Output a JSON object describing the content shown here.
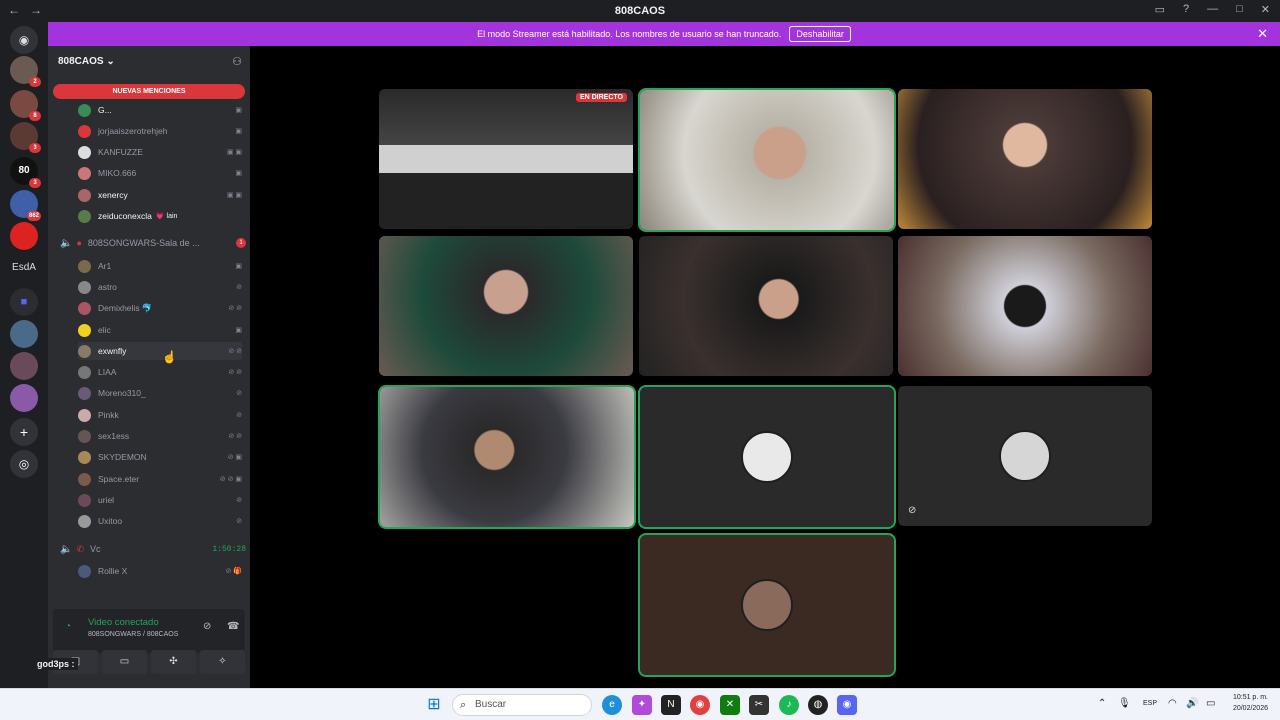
{
  "window": {
    "title": "808CAOS"
  },
  "banner": {
    "text": "El modo Streamer está habilitado. Los nombres de usuario se han truncado.",
    "button": "Deshabilitar"
  },
  "servers": [
    {
      "badge": "2"
    },
    {
      "badge": "8"
    },
    {
      "badge": "3"
    },
    {
      "badge": "3"
    },
    {
      "badge": "862"
    },
    {
      "badge": ""
    }
  ],
  "server_text": "EsdA",
  "guild": {
    "name": "808CAOS ⌄",
    "mentions": "NUEVAS MENCIONES"
  },
  "members_top": [
    {
      "name": "G...",
      "white": true,
      "icons": "▣"
    },
    {
      "name": "jorjaaiszerotrehjeh",
      "white": false,
      "icons": "▣"
    },
    {
      "name": "KANFUZZE",
      "white": false,
      "icons": "▣ ▣"
    },
    {
      "name": "MIKO.666",
      "white": false,
      "icons": "▣"
    },
    {
      "name": "xenercy",
      "white": true,
      "icons": "▣ ▣"
    },
    {
      "name": "zeiduconexcla",
      "white": true,
      "icons": "",
      "tag": "💗 lain"
    }
  ],
  "voice_channel": {
    "name": "808SONGWARS-Sala de ...",
    "badge": "1"
  },
  "members_voice": [
    {
      "name": "Ar1",
      "icons": "▣"
    },
    {
      "name": "astro",
      "icons": "⊘"
    },
    {
      "name": "Demixhelis 🐬",
      "icons": "⊘ ⊘"
    },
    {
      "name": "elic",
      "icons": "▣"
    },
    {
      "name": "exwnfly",
      "white": true,
      "icons": "⊘ ⊘"
    },
    {
      "name": "LIAA",
      "icons": "⊘ ⊘"
    },
    {
      "name": "Moreno310_",
      "icons": "⊘"
    },
    {
      "name": "Pinkk",
      "icons": "⊘"
    },
    {
      "name": "sex1ess",
      "icons": "⊘ ⊘"
    },
    {
      "name": "SKYDEMON",
      "icons": "⊘ ▣"
    },
    {
      "name": "Space.eter",
      "icons": "⊘ ⊘ ▣"
    },
    {
      "name": "uriel",
      "icons": "⊘"
    },
    {
      "name": "Uxitoo",
      "icons": "⊘"
    }
  ],
  "voice_channel_2": {
    "name": "Vc",
    "timer": "1:50:28"
  },
  "members_vc": [
    {
      "name": "Rollie X",
      "icons": "⊘ 🎁"
    }
  ],
  "voice_panel": {
    "title": "Video conectado",
    "subtitle": "808SONGWARS / 808CAOS"
  },
  "user": {
    "name": "god3ps :"
  },
  "tiles": [
    {
      "kind": "stream",
      "label": "EN DIRECTO",
      "speaking": false,
      "bg": "#3a3a3a"
    },
    {
      "kind": "cam",
      "speaking": true,
      "bg": "#b9b4a8"
    },
    {
      "kind": "cam",
      "speaking": false,
      "bg": "#4b3a38"
    },
    {
      "kind": "cam",
      "speaking": false,
      "bg": "#6b5a52"
    },
    {
      "kind": "cam",
      "speaking": false,
      "bg": "#3a302e"
    },
    {
      "kind": "cam",
      "speaking": false,
      "bg": "#7a6a60"
    },
    {
      "kind": "cam",
      "speaking": true,
      "bg": "#5a5e62"
    },
    {
      "kind": "avatar",
      "speaking": true,
      "bg": "#2b2a2a",
      "avatar_bg": "#e9e9e9"
    },
    {
      "kind": "avatar",
      "speaking": false,
      "bg": "#2b2a2a",
      "avatar_bg": "#d6d6d6",
      "muted": true
    },
    {
      "kind": "avatar",
      "speaking": true,
      "bg": "#3b2a22",
      "avatar_bg": "#8a6a5a"
    }
  ],
  "taskbar": {
    "search": "Buscar",
    "lang": "ESP",
    "time": "10:51 p. m.",
    "date": "20/02/2026"
  },
  "colors": {
    "accent": "#5865f2",
    "green": "#23a55a",
    "red": "#da373c",
    "banner": "#a334dd"
  }
}
